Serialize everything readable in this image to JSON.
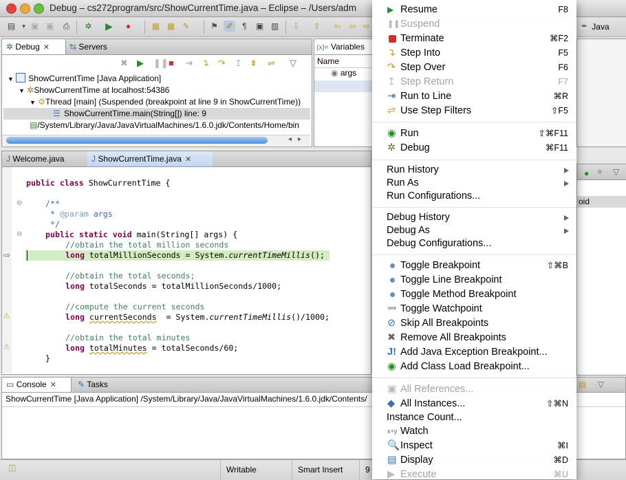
{
  "window": {
    "title": "Debug – cs272program/src/ShowCurrentTime.java – Eclipse – /Users/adm"
  },
  "perspective": {
    "label": "Java"
  },
  "debug_view": {
    "tabs": [
      {
        "label": "Debug"
      },
      {
        "label": "Servers"
      }
    ],
    "tree": [
      "ShowCurrentTime [Java Application]",
      "ShowCurrentTime at localhost:54386",
      "Thread [main] (Suspended (breakpoint at line 9 in ShowCurrentTime))",
      "ShowCurrentTime.main(String[]) line: 9",
      "/System/Library/Java/JavaVirtualMachines/1.6.0.jdk/Contents/Home/bin"
    ]
  },
  "variables_view": {
    "tab_label": "Variables",
    "column_name": "Name",
    "rows": [
      "args"
    ]
  },
  "right_panel": {
    "fragment": "oid"
  },
  "editor": {
    "tabs": [
      {
        "label": "Welcome.java"
      },
      {
        "label": "ShowCurrentTime.java"
      }
    ],
    "lines": {
      "l1_kw": "public class ",
      "l1_rest": "ShowCurrentTime {",
      "l3": "/**",
      "l4_a": " * ",
      "l4_b": "@param",
      "l4_c": " args",
      "l5": " */",
      "l6_kw": "public static void ",
      "l6_rest": "main(String[] args) {",
      "l7": "//obtain the total million seconds",
      "l8_kw": "long ",
      "l8_a": "totalMillionSeconds = System.",
      "l8_b": "currentTimeMillis",
      "l8_c": "();",
      "l10": "//obtain the total seconds;",
      "l11_kw": "long ",
      "l11_rest": "totalSeconds = totalMillionSeconds/1000;",
      "l13": "//compute the current seconds",
      "l14_kw": "long ",
      "l14_a": "currentSeconds",
      "l14_b": "  = System.",
      "l14_c": "currentTimeMillis",
      "l14_d": "()/1000;",
      "l16": "//obtain the total minutes",
      "l17_kw": "long ",
      "l17_a": "totalMinutes",
      "l17_b": " = totalSeconds/60;",
      "l18": "}"
    }
  },
  "console": {
    "tabs": [
      {
        "label": "Console"
      },
      {
        "label": "Tasks"
      }
    ],
    "header": "ShowCurrentTime [Java Application] /System/Library/Java/JavaVirtualMachines/1.6.0.jdk/Contents/"
  },
  "statusbar": {
    "writable": "Writable",
    "insert_mode": "Smart Insert",
    "position": "9"
  },
  "run_menu": {
    "items": [
      {
        "label": "Resume",
        "shortcut": "F8"
      },
      {
        "label": "Suspend",
        "shortcut": ""
      },
      {
        "label": "Terminate",
        "shortcut": "⌘F2"
      },
      {
        "label": "Step Into",
        "shortcut": "F5"
      },
      {
        "label": "Step Over",
        "shortcut": "F6"
      },
      {
        "label": "Step Return",
        "shortcut": "F7"
      },
      {
        "label": "Run to Line",
        "shortcut": "⌘R"
      },
      {
        "label": "Use Step Filters",
        "shortcut": "⇧F5"
      },
      {
        "label": "Run",
        "shortcut": "⇧⌘F11"
      },
      {
        "label": "Debug",
        "shortcut": "⌘F11"
      },
      {
        "label": "Run History",
        "shortcut": ""
      },
      {
        "label": "Run As",
        "shortcut": ""
      },
      {
        "label": "Run Configurations...",
        "shortcut": ""
      },
      {
        "label": "Debug History",
        "shortcut": ""
      },
      {
        "label": "Debug As",
        "shortcut": ""
      },
      {
        "label": "Debug Configurations...",
        "shortcut": ""
      },
      {
        "label": "Toggle Breakpoint",
        "shortcut": "⇧⌘B"
      },
      {
        "label": "Toggle Line Breakpoint",
        "shortcut": ""
      },
      {
        "label": "Toggle Method Breakpoint",
        "shortcut": ""
      },
      {
        "label": "Toggle Watchpoint",
        "shortcut": ""
      },
      {
        "label": "Skip All Breakpoints",
        "shortcut": ""
      },
      {
        "label": "Remove All Breakpoints",
        "shortcut": ""
      },
      {
        "label": "Add Java Exception Breakpoint...",
        "shortcut": ""
      },
      {
        "label": "Add Class Load Breakpoint...",
        "shortcut": ""
      },
      {
        "label": "All References...",
        "shortcut": ""
      },
      {
        "label": "All Instances...",
        "shortcut": "⇧⌘N"
      },
      {
        "label": "Instance Count...",
        "shortcut": ""
      },
      {
        "label": "Watch",
        "shortcut": ""
      },
      {
        "label": "Inspect",
        "shortcut": "⌘I"
      },
      {
        "label": "Display",
        "shortcut": "⌘D"
      },
      {
        "label": "Execute",
        "shortcut": "⌘U"
      }
    ]
  },
  "colors": {
    "keyword": "#7f0055",
    "comment": "#3f7f5f",
    "javadoc": "#3f5fbf",
    "current_line": "#d4ecc2",
    "selected_frame": "#d9d9d9",
    "breakpoint_dot": "#6b8fb3"
  }
}
